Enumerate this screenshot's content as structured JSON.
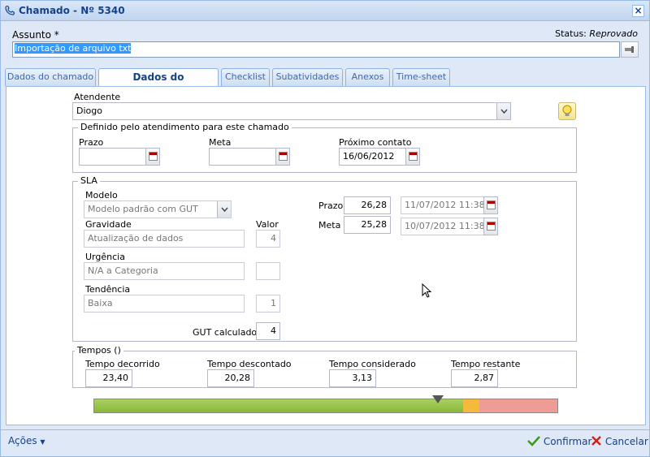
{
  "window": {
    "title": "Chamado - Nº 5340"
  },
  "assunto": {
    "label": "Assunto *",
    "value": "Importação de arquivo txt"
  },
  "status": {
    "label": "Status:",
    "value": "Reprovado"
  },
  "tabs": [
    {
      "label": "Dados do chamado",
      "active": false
    },
    {
      "label": "Dados do atendimento",
      "active": true
    },
    {
      "label": "Checklist",
      "active": false
    },
    {
      "label": "Subatividades",
      "active": false
    },
    {
      "label": "Anexos",
      "active": false
    },
    {
      "label": "Time-sheet",
      "active": false
    }
  ],
  "atendente": {
    "label": "Atendente",
    "value": "Diogo"
  },
  "definido": {
    "legend": "Definido pelo atendimento para este chamado",
    "prazo_label": "Prazo",
    "prazo_value": "",
    "meta_label": "Meta",
    "meta_value": "",
    "proximo_label": "Próximo contato",
    "proximo_value": "16/06/2012"
  },
  "sla": {
    "legend": "SLA",
    "modelo_label": "Modelo",
    "modelo_value": "Modelo padrão com GUT",
    "gravidade_label": "Gravidade",
    "gravidade_value": "Atualização de dados",
    "valor_label": "Valor",
    "gravidade_num": "4",
    "urgencia_label": "Urgência",
    "urgencia_value": "N/A a Categoria",
    "urgencia_num": "",
    "tendencia_label": "Tendência",
    "tendencia_value": "Baixa",
    "tendencia_num": "1",
    "gut_label": "GUT calculado -",
    "gut_value": "4",
    "prazo_label": "Prazo",
    "prazo_num": "26,28",
    "prazo_date": "11/07/2012 11:38",
    "meta_label": "Meta",
    "meta_num": "25,28",
    "meta_date": "10/07/2012 11:38"
  },
  "tempos": {
    "legend": "Tempos ()",
    "decorrido_label": "Tempo decorrido",
    "decorrido_value": "23,40",
    "descontado_label": "Tempo descontado",
    "descontado_value": "20,28",
    "considerado_label": "Tempo considerado",
    "considerado_value": "3,13",
    "restante_label": "Tempo restante",
    "restante_value": "2,87"
  },
  "progress": {
    "green_fraction": 0.797,
    "amber_fraction": 0.035,
    "red_fraction": 0.168,
    "marker_fraction": 0.743
  },
  "colors": {
    "green": "#8ab83a",
    "amber": "#f5b93c",
    "red": "#ef9b96",
    "title": "#15428b"
  },
  "footer": {
    "acoes_label": "Ações",
    "confirmar_label": "Confirmar",
    "cancelar_label": "Cancelar"
  },
  "icons": {
    "title": "phone-icon",
    "close": "close-icon",
    "clear": "clear-field-icon",
    "calendar": "calendar-icon",
    "bulb": "lightbulb-icon",
    "confirm": "checkmark-icon",
    "cancel": "x-icon"
  }
}
